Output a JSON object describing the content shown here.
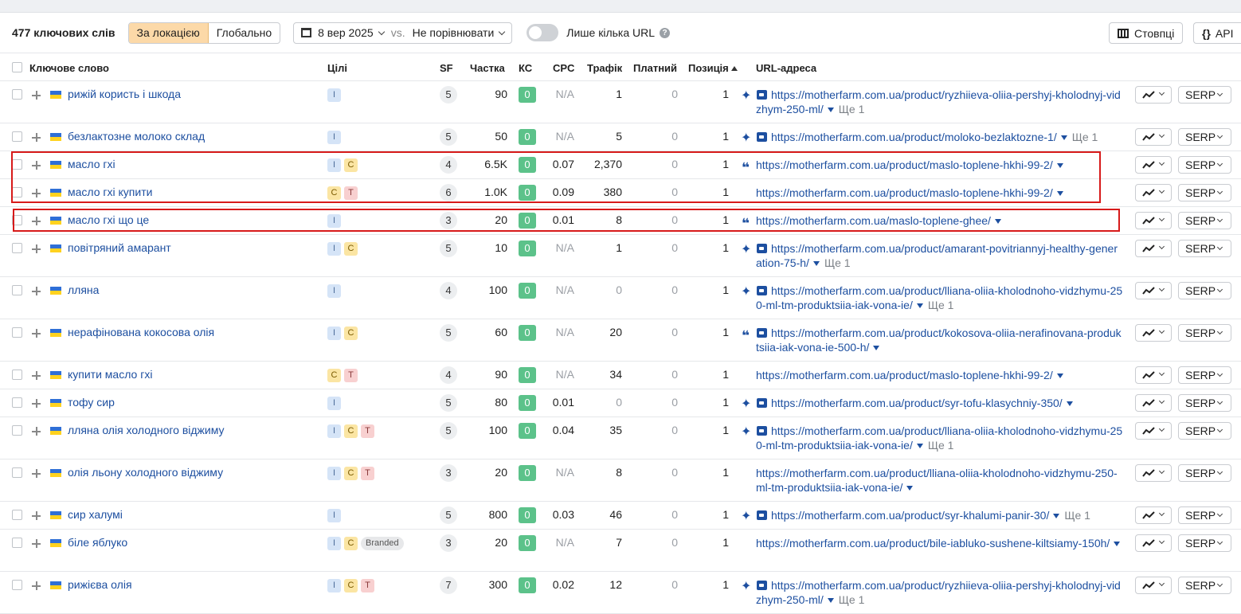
{
  "toolbar": {
    "keyword_count": "477 ключових слів",
    "scope_local": "За локацією",
    "scope_global": "Глобально",
    "date": "8 вер 2025",
    "vs": "vs.",
    "compare": "Не порівнювати",
    "only_few_urls": "Лише кілька URL",
    "help": "?",
    "columns": "Стовпці",
    "api": "API"
  },
  "table": {
    "headers": {
      "keyword": "Ключове слово",
      "intents": "Цілі",
      "sf": "SF",
      "share": "Частка",
      "kd": "КС",
      "cpc": "CPC",
      "traffic": "Трафік",
      "paid": "Платний",
      "position": "Позиція",
      "url": "URL-адреса"
    },
    "rows": [
      {
        "keyword": "рижій користь і шкода",
        "intents": [
          "I"
        ],
        "sf": "5",
        "share": "90",
        "kd": "0",
        "cpc": "N/A",
        "traffic": "1",
        "paid": "0",
        "pos": "1",
        "icon": "sparkle",
        "url": "https://motherfarm.com.ua/product/ryzhiieva-oliia-pershyj-kholodnyj-vidzhym-250-ml/",
        "more": "Ще 1"
      },
      {
        "keyword": "безлактозне молоко склад",
        "intents": [
          "I"
        ],
        "sf": "5",
        "share": "50",
        "kd": "0",
        "cpc": "N/A",
        "traffic": "5",
        "paid": "0",
        "pos": "1",
        "icon": "sparkle",
        "url": "https://motherfarm.com.ua/product/moloko-bezlaktozne-1/",
        "more": "Ще 1"
      },
      {
        "keyword": "масло гхі",
        "intents": [
          "I",
          "C"
        ],
        "sf": "4",
        "share": "6.5K",
        "kd": "0",
        "cpc": "0.07",
        "traffic": "2,370",
        "paid": "0",
        "pos": "1",
        "icon": "quote",
        "url": "https://motherfarm.com.ua/product/maslo-toplene-hkhi-99-2/",
        "more": ""
      },
      {
        "keyword": "масло гхі купити",
        "intents": [
          "C",
          "T"
        ],
        "sf": "6",
        "share": "1.0K",
        "kd": "0",
        "cpc": "0.09",
        "traffic": "380",
        "paid": "0",
        "pos": "1",
        "icon": "",
        "url": "https://motherfarm.com.ua/product/maslo-toplene-hkhi-99-2/",
        "more": ""
      },
      {
        "keyword": "масло гхі що це",
        "intents": [
          "I"
        ],
        "sf": "3",
        "share": "20",
        "kd": "0",
        "cpc": "0.01",
        "traffic": "8",
        "paid": "0",
        "pos": "1",
        "icon": "quote",
        "url": "https://motherfarm.com.ua/maslo-toplene-ghee/",
        "more": ""
      },
      {
        "keyword": "повітряний амарант",
        "intents": [
          "I",
          "C"
        ],
        "sf": "5",
        "share": "10",
        "kd": "0",
        "cpc": "N/A",
        "traffic": "1",
        "paid": "0",
        "pos": "1",
        "icon": "sparkle",
        "url": "https://motherfarm.com.ua/product/amarant-povitriannyj-healthy-generation-75-h/",
        "more": "Ще 1"
      },
      {
        "keyword": "лляна",
        "intents": [
          "I"
        ],
        "sf": "4",
        "share": "100",
        "kd": "0",
        "cpc": "N/A",
        "traffic": "0",
        "paid": "0",
        "pos": "1",
        "icon": "sparkle",
        "url": "https://motherfarm.com.ua/product/lliana-oliia-kholodnoho-vidzhymu-250-ml-tm-produktsiia-iak-vona-ie/",
        "more": "Ще 1"
      },
      {
        "keyword": "нерафінована кокосова олія",
        "intents": [
          "I",
          "C"
        ],
        "sf": "5",
        "share": "60",
        "kd": "0",
        "cpc": "N/A",
        "traffic": "20",
        "paid": "0",
        "pos": "1",
        "icon": "quote-img",
        "url": "https://motherfarm.com.ua/product/kokosova-oliia-nerafinovana-produktsiia-iak-vona-ie-500-h/",
        "more": ""
      },
      {
        "keyword": "купити масло гхі",
        "intents": [
          "C",
          "T"
        ],
        "sf": "4",
        "share": "90",
        "kd": "0",
        "cpc": "N/A",
        "traffic": "34",
        "paid": "0",
        "pos": "1",
        "icon": "",
        "url": "https://motherfarm.com.ua/product/maslo-toplene-hkhi-99-2/",
        "more": ""
      },
      {
        "keyword": "тофу сир",
        "intents": [
          "I"
        ],
        "sf": "5",
        "share": "80",
        "kd": "0",
        "cpc": "0.01",
        "traffic": "0",
        "paid": "0",
        "pos": "1",
        "icon": "sparkle",
        "url": "https://motherfarm.com.ua/product/syr-tofu-klasychniy-350/",
        "more": ""
      },
      {
        "keyword": "лляна олія холодного віджиму",
        "intents": [
          "I",
          "C",
          "T"
        ],
        "sf": "5",
        "share": "100",
        "kd": "0",
        "cpc": "0.04",
        "traffic": "35",
        "paid": "0",
        "pos": "1",
        "icon": "sparkle",
        "url": "https://motherfarm.com.ua/product/lliana-oliia-kholodnoho-vidzhymu-250-ml-tm-produktsiia-iak-vona-ie/",
        "more": "Ще 1"
      },
      {
        "keyword": "олія льону холодного віджиму",
        "intents": [
          "I",
          "C",
          "T"
        ],
        "sf": "3",
        "share": "20",
        "kd": "0",
        "cpc": "N/A",
        "traffic": "8",
        "paid": "0",
        "pos": "1",
        "icon": "",
        "url": "https://motherfarm.com.ua/product/lliana-oliia-kholodnoho-vidzhymu-250-ml-tm-produktsiia-iak-vona-ie/",
        "more": ""
      },
      {
        "keyword": "сир халумі",
        "intents": [
          "I"
        ],
        "sf": "5",
        "share": "800",
        "kd": "0",
        "cpc": "0.03",
        "traffic": "46",
        "paid": "0",
        "pos": "1",
        "icon": "sparkle",
        "url": "https://motherfarm.com.ua/product/syr-khalumi-panir-30/",
        "more": "Ще 1"
      },
      {
        "keyword": "біле яблуко",
        "intents": [
          "I",
          "C",
          "Branded"
        ],
        "sf": "3",
        "share": "20",
        "kd": "0",
        "cpc": "N/A",
        "traffic": "7",
        "paid": "0",
        "pos": "1",
        "icon": "",
        "url": "https://motherfarm.com.ua/product/bile-iabluko-sushene-kiltsiamy-150h/",
        "more": ""
      },
      {
        "keyword": "рижієва олія",
        "intents": [
          "I",
          "C",
          "T"
        ],
        "sf": "7",
        "share": "300",
        "kd": "0",
        "cpc": "0.02",
        "traffic": "12",
        "paid": "0",
        "pos": "1",
        "icon": "sparkle",
        "url": "https://motherfarm.com.ua/product/ryzhiieva-oliia-pershyj-kholodnyj-vidzhym-250-ml/",
        "more": "Ще 1"
      }
    ],
    "serp_label": "SERP"
  },
  "colors": {
    "accent_link": "#1d4fa0",
    "kd_green": "#5cc28a",
    "highlight_red": "#d71a1a",
    "active_scope": "#fcd9a8"
  }
}
